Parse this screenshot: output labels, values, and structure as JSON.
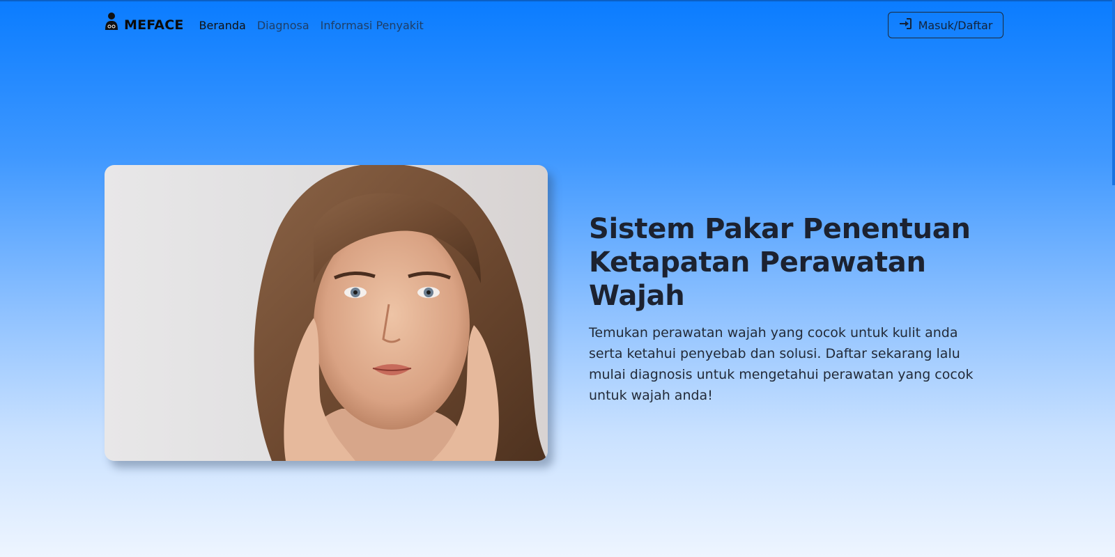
{
  "brand": {
    "name": "MEFACE",
    "icon": "doctor-icon"
  },
  "nav": {
    "items": [
      {
        "label": "Beranda",
        "active": true
      },
      {
        "label": "Diagnosa",
        "active": false
      },
      {
        "label": "Informasi Penyakit",
        "active": false
      }
    ],
    "login_label": "Masuk/Daftar",
    "login_icon": "sign-in-icon"
  },
  "hero": {
    "title": "Sistem Pakar Penentuan Ketapatan Perawatan Wajah",
    "description": "Temukan perawatan wajah yang cocok untuk kulit anda serta ketahui penyebab dan solusi. Daftar sekarang lalu mulai diagnosis untuk mengetahui perawatan yang cocok untuk wajah anda!",
    "image": "woman-face-photo"
  },
  "colors": {
    "gradient_top": "#0a7cff",
    "gradient_bottom": "#eef5ff",
    "text_dark": "#1c2230",
    "nav_inactive": "#1f3e66"
  }
}
